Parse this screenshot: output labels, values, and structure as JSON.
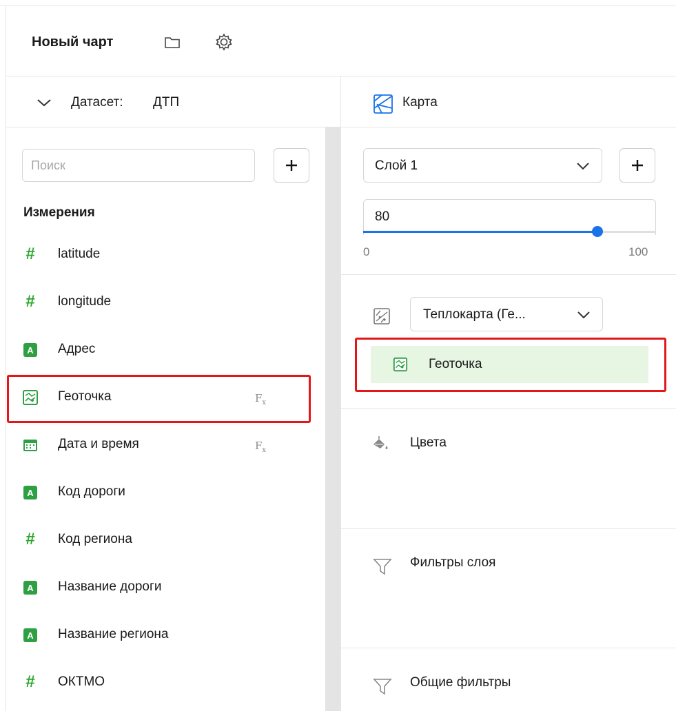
{
  "header": {
    "title": "Новый чарт"
  },
  "dataset": {
    "label": "Датасет:",
    "name": "ДТП"
  },
  "viz": {
    "label": "Карта"
  },
  "search": {
    "placeholder": "Поиск",
    "value": ""
  },
  "dimensions": {
    "heading": "Измерения",
    "items": [
      {
        "label": "latitude",
        "icon": "hash-icon",
        "type_glyph": "#"
      },
      {
        "label": "longitude",
        "icon": "hash-icon",
        "type_glyph": "#"
      },
      {
        "label": "Адрес",
        "icon": "string-icon",
        "type_glyph": "A"
      },
      {
        "label": "Геоточка",
        "icon": "geopoint-icon",
        "fx": "F",
        "fx_sub": "x"
      },
      {
        "label": "Дата и время",
        "icon": "datetime-icon",
        "fx": "F",
        "fx_sub": "x"
      },
      {
        "label": "Код дороги",
        "icon": "string-icon",
        "type_glyph": "A"
      },
      {
        "label": "Код региона",
        "icon": "hash-icon",
        "type_glyph": "#"
      },
      {
        "label": "Название дороги",
        "icon": "string-icon",
        "type_glyph": "A"
      },
      {
        "label": "Название региона",
        "icon": "string-icon",
        "type_glyph": "A"
      },
      {
        "label": "ОКТМО",
        "icon": "hash-icon",
        "type_glyph": "#"
      }
    ]
  },
  "layer": {
    "selected": "Слой 1",
    "opacity": {
      "value": "80",
      "min": "0",
      "max": "100",
      "level": 0.8
    }
  },
  "visualization": {
    "selected": "Теплокарта (Ге...",
    "geopoint_field": "Геоточка"
  },
  "sections": {
    "colors": "Цвета",
    "layer_filters": "Фильтры слоя",
    "common_filters": "Общие фильтры"
  },
  "colors": {
    "accent": "#1a73e8",
    "field_green": "#2ea043",
    "highlight_red": "#e4161a",
    "chip_green": "#e7f5e3"
  }
}
